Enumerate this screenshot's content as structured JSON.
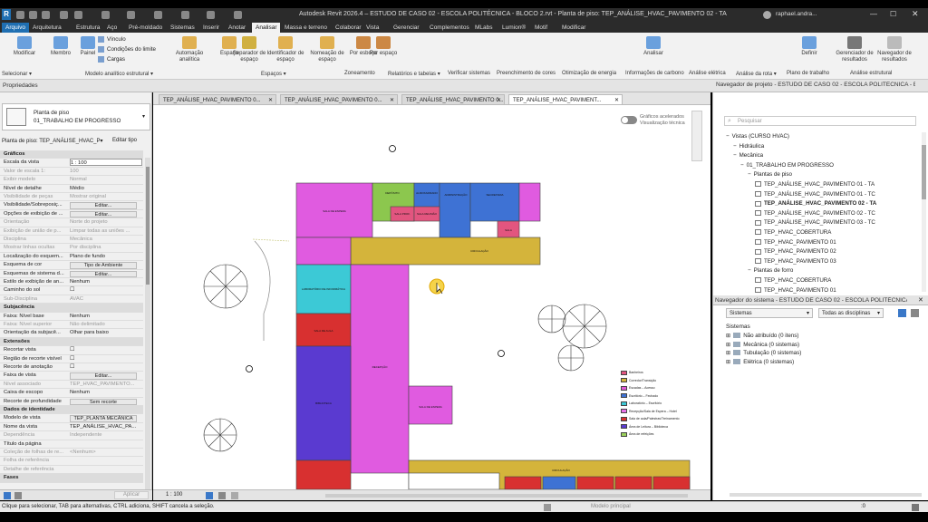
{
  "titlebar": {
    "title": "Autodesk Revit 2026.4 – ESTUDO DE CASO 02 - ESCOLA POLITÉCNICA - BLOCO 2.rvt - Planta de piso: TEP_ANÁLISE_HVAC_PAVIMENTO 02 - TA",
    "user": "raphael.andra...",
    "app_icon": "R"
  },
  "menu": [
    "Arquivo",
    "Arquitetura",
    "Estrutura",
    "Aço",
    "Pré-moldado",
    "Sistemas",
    "Inserir",
    "Anotar",
    "Analisar",
    "Massa e terreno",
    "Colaborar",
    "Vista",
    "Gerenciar",
    "Complementos",
    "MLabs",
    "Lumion®",
    "Motif",
    "Modificar"
  ],
  "menu_active": "Analisar",
  "ribbon": {
    "buttons": [
      "Modificar",
      "Membro",
      "Painel",
      "Automação analítica",
      "Espaço",
      "Separador de espaço",
      "Identificador de espaço",
      "Nomeação de espaço",
      "Por esboço",
      "Por espaço",
      "Analisar",
      "Definir",
      "Gerenciador de resultados",
      "Navegador de resultados"
    ],
    "small": [
      "Vínculo",
      "Condições do limite",
      "Cargas"
    ],
    "groups": [
      "Selecionar ▾",
      "Modelo analítico estrutural ▾",
      "Espaços ▾",
      "Zoneamento",
      "Relatórios e tabelas ▾",
      "Verificar sistemas",
      "Preenchimento de cores",
      "Otimização de energia",
      "Informações de carbono",
      "Análise elétrica",
      "Análise da rota ▾",
      "Plano de trabalho",
      "Análise estrutural"
    ]
  },
  "properties": {
    "title": "Propriedades",
    "type_line1": "Planta de piso",
    "type_line2": "01_TRABALHO EM PROGRESSO",
    "selector": "Planta de piso: TEP_ANÁLISE_HVAC_P▾",
    "edit_type": "Editar tipo",
    "rows": [
      {
        "k": "Gráficos",
        "v": "",
        "s": "sec"
      },
      {
        "k": "Escala da vista",
        "v": "1 : 100",
        "s": ""
      },
      {
        "k": "Valor de escala    1:",
        "v": "100",
        "s": "dim"
      },
      {
        "k": "Exibir modelo",
        "v": "Normal",
        "s": "dim"
      },
      {
        "k": "Nível de detalhe",
        "v": "Médio",
        "s": ""
      },
      {
        "k": "Visibilidade de peças",
        "v": "Mostrar original",
        "s": "dim"
      },
      {
        "k": "Visibilidade/Sobreposiç...",
        "v": "Editar...",
        "s": "btn"
      },
      {
        "k": "Opções de exibição de ...",
        "v": "Editar...",
        "s": "btn"
      },
      {
        "k": "Orientação",
        "v": "Norte do projeto",
        "s": "dim"
      },
      {
        "k": "Exibição de união de p...",
        "v": "Limpar todas as uniões ...",
        "s": "dim"
      },
      {
        "k": "Disciplina",
        "v": "Mecânica",
        "s": "dim"
      },
      {
        "k": "Mostrar linhas ocultas",
        "v": "Por disciplina",
        "s": "dim"
      },
      {
        "k": "Localização do esquem...",
        "v": "Plano de fundo",
        "s": ""
      },
      {
        "k": "Esquema de cor",
        "v": "Tipo de Ambiente",
        "s": "btn"
      },
      {
        "k": "Esquemas de sistema d...",
        "v": "Editar...",
        "s": "btn"
      },
      {
        "k": "Estilo de exibição de an...",
        "v": "Nenhum",
        "s": ""
      },
      {
        "k": "Caminho do sol",
        "v": "☐",
        "s": ""
      },
      {
        "k": "Sub-Disciplina",
        "v": "AVAC",
        "s": "dim"
      },
      {
        "k": "Subjacência",
        "v": "",
        "s": "sec"
      },
      {
        "k": "Faixa: Nível base",
        "v": "Nenhum",
        "s": ""
      },
      {
        "k": "Faixa: Nível superior",
        "v": "Não delimitado",
        "s": "dim"
      },
      {
        "k": "Orientação da subjacê...",
        "v": "Olhar para baixo",
        "s": ""
      },
      {
        "k": "Extensões",
        "v": "",
        "s": "sec"
      },
      {
        "k": "Recortar vista",
        "v": "☐",
        "s": ""
      },
      {
        "k": "Região de recorte visível",
        "v": "☐",
        "s": ""
      },
      {
        "k": "Recorte de anotação",
        "v": "☐",
        "s": ""
      },
      {
        "k": "Faixa de vista",
        "v": "Editar...",
        "s": "btn"
      },
      {
        "k": "Nível associado",
        "v": "TEP_HVAC_PAVIMENTO...",
        "s": "dim"
      },
      {
        "k": "Caixa de escopo",
        "v": "Nenhum",
        "s": ""
      },
      {
        "k": "Recorte de profundidade",
        "v": "Sem recorte",
        "s": "btn"
      },
      {
        "k": "Dados de identidade",
        "v": "",
        "s": "sec"
      },
      {
        "k": "Modelo de vista",
        "v": "TEP_PLANTA MECÂNICA",
        "s": "btn"
      },
      {
        "k": "Nome da vista",
        "v": "TEP_ANÁLISE_HVAC_PA...",
        "s": ""
      },
      {
        "k": "Dependência",
        "v": "Independente",
        "s": "dim"
      },
      {
        "k": "Título da página",
        "v": "",
        "s": ""
      },
      {
        "k": "Coleção de folhas de re...",
        "v": "<Nenhum>",
        "s": "dim"
      },
      {
        "k": "Folha de referência",
        "v": "",
        "s": "dim"
      },
      {
        "k": "Detalhe de referência",
        "v": "",
        "s": "dim"
      },
      {
        "k": "Fases",
        "v": "",
        "s": "sec"
      }
    ],
    "apply": "Aplicar"
  },
  "tabs": [
    "TEP_ANÁLISE_HVAC_PAVIMENTO 0...",
    "TEP_ANÁLISE_HVAC_PAVIMENTO 0...",
    "TEP_ANÁLISE_HVAC_PAVIMENTO 0...",
    "TEP_ANÁLISE_HVAC_PAVIMENT..."
  ],
  "toggle_label": "Gráficos acelerados",
  "toggle_sub": "Visualização técnica",
  "view_scale": "1 : 100",
  "rooms": [
    "SALA DE ESPERA",
    "DEPÓSITO",
    "ADMINISTRAÇÃO",
    "SECRETARIA",
    "ALMOXARIFADO",
    "SALA PROF.",
    "SALA REUNIÃO",
    "CIRCULAÇÃO",
    "LABORATÓRIO DE INFORMÁTICA",
    "SALA DE AULA",
    "RECEPÇÃO",
    "BIBLIOTECA",
    "SALA DE ESPERA",
    "CIRCULAÇÃO",
    "SALA"
  ],
  "legend": [
    {
      "label": "Banheiros",
      "color": "#e2557f"
    },
    {
      "label": "Corredor/Transição",
      "color": "#d4b43b"
    },
    {
      "label": "Escadas – Acesso",
      "color": "#e05bd6"
    },
    {
      "label": "Escritório – Fechado",
      "color": "#3e72d4"
    },
    {
      "label": "Laboratório – Escritório",
      "color": "#3cc9d6"
    },
    {
      "label": "Recepção/Sala de Espera – Hotel",
      "color": "#e872e8"
    },
    {
      "label": "Sala de aula/Palestras/Treinamento",
      "color": "#d83030"
    },
    {
      "label": "Área de Leitura – Biblioteca",
      "color": "#5a3ad0"
    },
    {
      "label": "Área de refeições",
      "color": "#9ad05a"
    }
  ],
  "navigator": {
    "title": "Navegador de projeto - ESTUDO DE CASO 02 - ESCOLA POLITÉCNICA - BLOCO 2",
    "search": "Pesquisar",
    "items": [
      {
        "t": "Vistas (CURSO HVAC)",
        "lvl": 0,
        "b": false
      },
      {
        "t": "Hidráulica",
        "lvl": 1,
        "b": false
      },
      {
        "t": "Mecânica",
        "lvl": 1,
        "b": false
      },
      {
        "t": "01_TRABALHO EM PROGRESSO",
        "lvl": 2,
        "b": false
      },
      {
        "t": "Plantas de piso",
        "lvl": 3,
        "b": false
      },
      {
        "t": "TEP_ANÁLISE_HVAC_PAVIMENTO 01 - TA",
        "lvl": 4,
        "b": false
      },
      {
        "t": "TEP_ANÁLISE_HVAC_PAVIMENTO 01 - TC",
        "lvl": 4,
        "b": false
      },
      {
        "t": "TEP_ANÁLISE_HVAC_PAVIMENTO 02 - TA",
        "lvl": 4,
        "b": true
      },
      {
        "t": "TEP_ANÁLISE_HVAC_PAVIMENTO 02 - TC",
        "lvl": 4,
        "b": false
      },
      {
        "t": "TEP_ANÁLISE_HVAC_PAVIMENTO 03 - TC",
        "lvl": 4,
        "b": false
      },
      {
        "t": "TEP_HVAC_COBERTURA",
        "lvl": 4,
        "b": false
      },
      {
        "t": "TEP_HVAC_PAVIMENTO 01",
        "lvl": 4,
        "b": false
      },
      {
        "t": "TEP_HVAC_PAVIMENTO 02",
        "lvl": 4,
        "b": false
      },
      {
        "t": "TEP_HVAC_PAVIMENTO 03",
        "lvl": 4,
        "b": false
      },
      {
        "t": "Plantas de forro",
        "lvl": 3,
        "b": false
      },
      {
        "t": "TEP_HVAC_COBERTURA",
        "lvl": 4,
        "b": false
      },
      {
        "t": "TEP_HVAC_PAVIMENTO 01",
        "lvl": 4,
        "b": false
      }
    ]
  },
  "sysnav": {
    "title": "Navegador do sistema - ESTUDO DE CASO 02 - ESCOLA POLITÉCNICA - BL...",
    "dd1": "Sistemas",
    "dd2": "Todas as disciplinas",
    "header": "Sistemas",
    "items": [
      "Não atribuído (0 itens)",
      "Mecânica (0 sistemas)",
      "Tubulação (0 sistemas)",
      "Elétrica (0 sistemas)"
    ]
  },
  "status": {
    "hint": "Clique para selecionar, TAB para alternativas, CTRL adiciona, SHIFT cancela a seleção.",
    "model": "Modelo principal",
    "zero": ":0"
  }
}
